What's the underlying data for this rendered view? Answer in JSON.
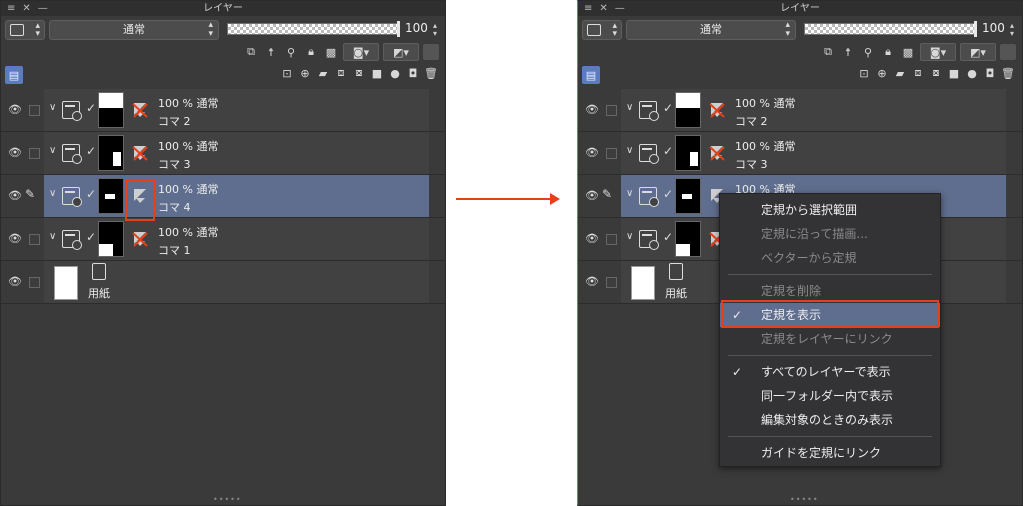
{
  "panel": {
    "title": "レイヤー",
    "blend_mode": "通常",
    "opacity": "100"
  },
  "layers": [
    {
      "opacity_mode": "100 % 通常",
      "name": "コマ 2"
    },
    {
      "opacity_mode": "100 % 通常",
      "name": "コマ 3"
    },
    {
      "opacity_mode": "100 % 通常",
      "name": "コマ 4"
    },
    {
      "opacity_mode": "100 % 通常",
      "name": "コマ 1"
    }
  ],
  "paper_layer": {
    "name": "用紙"
  },
  "context_menu": {
    "items": [
      {
        "label": "定規から選択範囲",
        "disabled": false,
        "checked": false
      },
      {
        "label": "定規に沿って描画...",
        "disabled": true,
        "checked": false
      },
      {
        "label": "ベクターから定規",
        "disabled": true,
        "checked": false
      },
      {
        "label": "定規を削除",
        "disabled": true,
        "checked": false
      },
      {
        "label": "定規を表示",
        "disabled": false,
        "checked": true
      },
      {
        "label": "定規をレイヤーにリンク",
        "disabled": true,
        "checked": false
      },
      {
        "label": "すべてのレイヤーで表示",
        "disabled": false,
        "checked": true
      },
      {
        "label": "同一フォルダー内で表示",
        "disabled": false,
        "checked": false
      },
      {
        "label": "編集対象のときのみ表示",
        "disabled": false,
        "checked": false
      },
      {
        "label": "ガイドを定規にリンク",
        "disabled": false,
        "checked": false
      }
    ],
    "check_glyph": "✓"
  },
  "colors": {
    "highlight_red": "#e6401a",
    "selected_row": "#5f6d8e",
    "panel_bg": "#3a3a3a"
  },
  "icons": [
    "eye-icon",
    "pen-icon",
    "frame-folder-icon",
    "ruler-icon",
    "ruler-hidden-icon",
    "paper-icon",
    "lock-icon",
    "new-layer-icon",
    "trash-icon",
    "arrow-right-icon"
  ]
}
